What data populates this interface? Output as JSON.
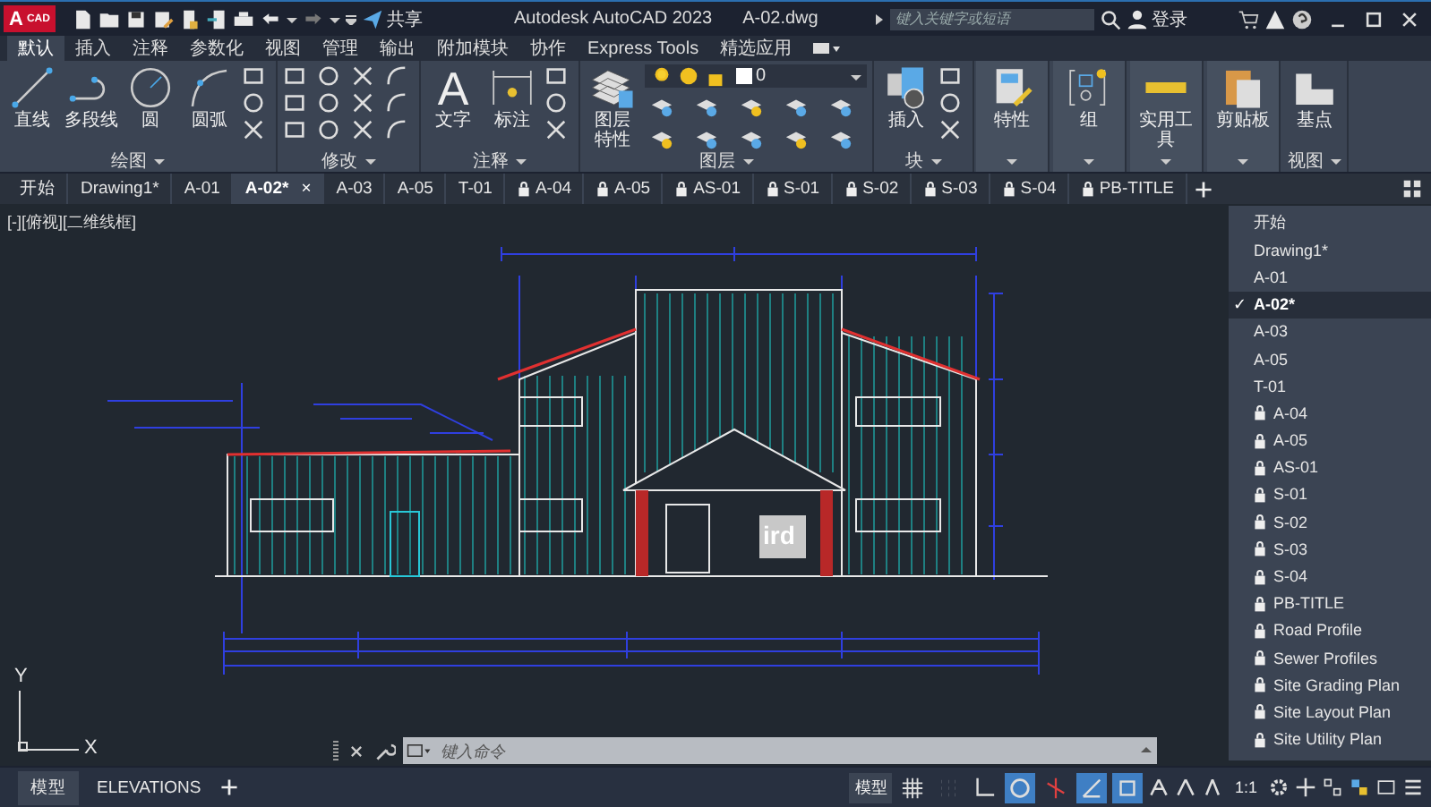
{
  "title_bar": {
    "logo_letter": "A",
    "logo_badge": "CAD",
    "share": "共享",
    "title": "Autodesk AutoCAD 2023",
    "file": "A-02.dwg",
    "search_placeholder": "键入关键字或短语",
    "login": "登录"
  },
  "ribbon_tabs": [
    {
      "label": "默认",
      "selected": true
    },
    {
      "label": "插入",
      "selected": false
    },
    {
      "label": "注释",
      "selected": false
    },
    {
      "label": "参数化",
      "selected": false
    },
    {
      "label": "视图",
      "selected": false
    },
    {
      "label": "管理",
      "selected": false
    },
    {
      "label": "输出",
      "selected": false
    },
    {
      "label": "附加模块",
      "selected": false
    },
    {
      "label": "协作",
      "selected": false
    },
    {
      "label": "Express Tools",
      "selected": false
    },
    {
      "label": "精选应用",
      "selected": false
    }
  ],
  "ribbon_panels": [
    {
      "kind": "draw",
      "title": "绘图",
      "tools": [
        {
          "kind": "line",
          "label": "直线"
        },
        {
          "kind": "polyline",
          "label": "多段线"
        },
        {
          "kind": "circle",
          "label": "圆"
        },
        {
          "kind": "arc",
          "label": "圆弧"
        }
      ]
    },
    {
      "kind": "modify",
      "title": "修改"
    },
    {
      "kind": "annotate",
      "title": "注释",
      "tools": [
        {
          "kind": "text",
          "label": "文字",
          "glyph": "A"
        },
        {
          "kind": "dimension",
          "label": "标注"
        }
      ]
    },
    {
      "kind": "layers",
      "title": "图层",
      "layer_value": "0",
      "tools": [
        {
          "kind": "layer-properties",
          "label": "图层特性"
        }
      ]
    },
    {
      "kind": "block",
      "title": "块",
      "tools": [
        {
          "kind": "insert",
          "label": "插入"
        }
      ]
    },
    {
      "kind": "big",
      "tools": [
        {
          "kind": "properties",
          "label": "特性"
        }
      ]
    },
    {
      "kind": "big",
      "tools": [
        {
          "kind": "group",
          "label": "组"
        }
      ]
    },
    {
      "kind": "big",
      "tools": [
        {
          "kind": "ruler",
          "label": "实用工具"
        }
      ]
    },
    {
      "kind": "big",
      "tools": [
        {
          "kind": "clipboard",
          "label": "剪贴板"
        }
      ]
    },
    {
      "kind": "view",
      "title": "视图",
      "tools": [
        {
          "kind": "basepoint",
          "label": "基点"
        }
      ]
    }
  ],
  "file_tab_close": "×",
  "file_tabs": [
    {
      "label": "开始",
      "selected": false,
      "locked": false
    },
    {
      "label": "Drawing1*",
      "selected": false,
      "locked": false
    },
    {
      "label": "A-01",
      "selected": false,
      "locked": false
    },
    {
      "label": "A-02*",
      "selected": true,
      "locked": false
    },
    {
      "label": "A-03",
      "selected": false,
      "locked": false
    },
    {
      "label": "A-05",
      "selected": false,
      "locked": false
    },
    {
      "label": "T-01",
      "selected": false,
      "locked": false
    },
    {
      "label": "A-04",
      "selected": false,
      "locked": true
    },
    {
      "label": "A-05",
      "selected": false,
      "locked": true
    },
    {
      "label": "AS-01",
      "selected": false,
      "locked": true
    },
    {
      "label": "S-01",
      "selected": false,
      "locked": true
    },
    {
      "label": "S-02",
      "selected": false,
      "locked": true
    },
    {
      "label": "S-03",
      "selected": false,
      "locked": true
    },
    {
      "label": "S-04",
      "selected": false,
      "locked": true
    },
    {
      "label": "PB-TITLE",
      "selected": false,
      "locked": true
    }
  ],
  "viewport_label": "[-][俯视][二维线框]",
  "drawing": {
    "sign_text": "ird"
  },
  "ucs": {
    "x": "X",
    "y": "Y"
  },
  "drawing_list_check": "✓",
  "drawing_list": [
    {
      "label": "开始",
      "selected": false,
      "locked": false
    },
    {
      "label": "Drawing1*",
      "selected": false,
      "locked": false
    },
    {
      "label": "A-01",
      "selected": false,
      "locked": false
    },
    {
      "label": "A-02*",
      "selected": true,
      "locked": false
    },
    {
      "label": "A-03",
      "selected": false,
      "locked": false
    },
    {
      "label": "A-05",
      "selected": false,
      "locked": false
    },
    {
      "label": "T-01",
      "selected": false,
      "locked": false
    },
    {
      "label": "A-04",
      "selected": false,
      "locked": true
    },
    {
      "label": "A-05",
      "selected": false,
      "locked": true
    },
    {
      "label": "AS-01",
      "selected": false,
      "locked": true
    },
    {
      "label": "S-01",
      "selected": false,
      "locked": true
    },
    {
      "label": "S-02",
      "selected": false,
      "locked": true
    },
    {
      "label": "S-03",
      "selected": false,
      "locked": true
    },
    {
      "label": "S-04",
      "selected": false,
      "locked": true
    },
    {
      "label": "PB-TITLE",
      "selected": false,
      "locked": true
    },
    {
      "label": "Road Profile",
      "selected": false,
      "locked": true
    },
    {
      "label": "Sewer Profiles",
      "selected": false,
      "locked": true
    },
    {
      "label": "Site Grading Plan",
      "selected": false,
      "locked": true
    },
    {
      "label": "Site Layout Plan",
      "selected": false,
      "locked": true
    },
    {
      "label": "Site Utility Plan",
      "selected": false,
      "locked": true
    }
  ],
  "command_line": {
    "placeholder": "键入命令"
  },
  "layout_tabs": [
    {
      "label": "模型",
      "selected": true
    },
    {
      "label": "ELEVATIONS",
      "selected": false
    }
  ],
  "status_bar": {
    "model": "模型",
    "scale": "1:1",
    "toggles": [
      {
        "kind": "grid",
        "on": false
      },
      {
        "kind": "snap",
        "on": false
      },
      {
        "kind": "ortho",
        "on": false
      },
      {
        "kind": "polar",
        "on": true
      },
      {
        "kind": "isometric",
        "on": false
      },
      {
        "kind": "tracking",
        "on": true
      },
      {
        "kind": "osnap",
        "on": true
      }
    ]
  }
}
